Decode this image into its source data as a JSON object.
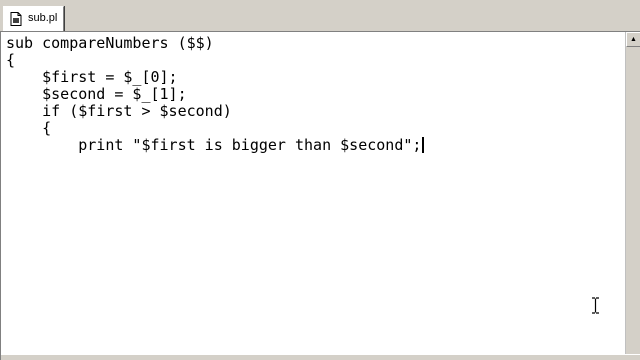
{
  "tab": {
    "title": "sub.pl",
    "icon": "perl-file-icon"
  },
  "editor": {
    "lines": [
      "sub compareNumbers ($$)",
      "{",
      "    $first = $_[0];",
      "    $second = $_[1];",
      "    if ($first > $second)",
      "    {",
      "        print \"$first is bigger than $second\";"
    ]
  },
  "scrollbar": {
    "up_arrow": "▲"
  },
  "colors": {
    "chrome": "#d4d0c8",
    "editor_bg": "#ffffff",
    "text": "#000000"
  }
}
